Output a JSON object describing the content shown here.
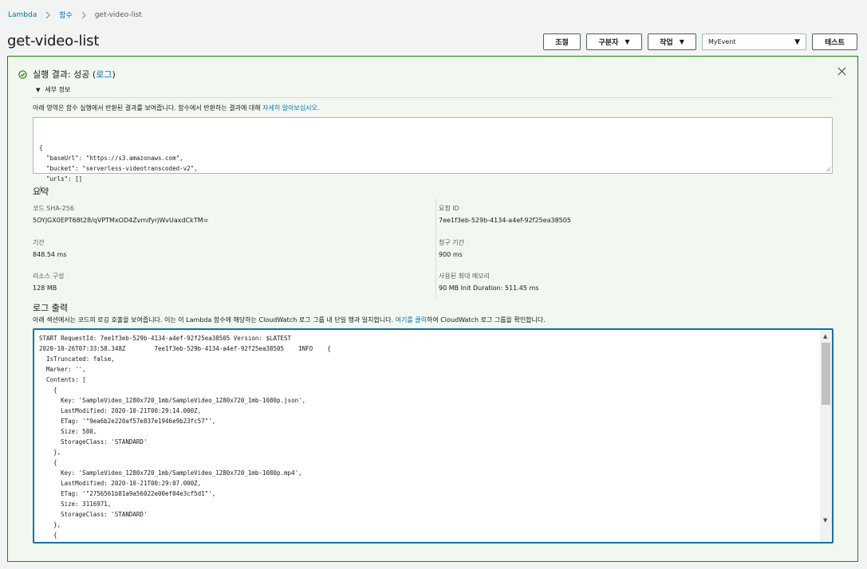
{
  "breadcrumb": {
    "items": [
      "Lambda",
      "함수"
    ],
    "current": "get-video-list"
  },
  "page_title": "get-video-list",
  "toolbar": {
    "adjust_label": "조절",
    "action_label": "구분자",
    "work_label": "작업",
    "event_select_value": "MyEvent",
    "test_label": "테스트"
  },
  "colors": {
    "success_border": "#1d8102",
    "link": "#0073bb",
    "focus": "#0073bb"
  },
  "result": {
    "status_prefix": "실행 결과: 성공 (",
    "status_link": "로그",
    "status_suffix": ")",
    "details_label": "세부 정보",
    "description_prefix": "아래 영역은 함수 실행에서 반환된 결과를 보여줍니다. 함수에서 반환하는 결과에 대해 ",
    "description_link": "자세히 알아보십시오",
    "description_suffix": ".",
    "json_output": "{\n  \"baseUrl\": \"https://s3.amazonaws.com\",\n  \"bucket\": \"serverless-videotranscoded-v2\",\n  \"urls\": []\n}"
  },
  "summary": {
    "title": "요약",
    "code_sha_label": "코드 SHA-256",
    "code_sha_value": "5OYjGX0EPT68t28/qVPTMxOD4ZvmifyrjWvUaxdCkTM=",
    "request_id_label": "요청 ID",
    "request_id_value": "7ee1f3eb-529b-4134-a4ef-92f25ea38505",
    "duration_label": "기간",
    "duration_value": "848.54 ms",
    "billed_label": "청구 기간",
    "billed_value": "900 ms",
    "resources_label": "리소스 구성",
    "resources_value": "128 MB",
    "max_memory_label": "사용된 최대 메모리",
    "max_memory_value": "90 MB Init Duration: 511.45 ms"
  },
  "log": {
    "title": "로그 출력",
    "description_prefix": "아래 섹션에서는 코드의 로깅 호출을 보여줍니다. 이는 이 Lambda 함수에 해당하는 CloudWatch 로그 그룹 내 단일 행과 일치합니다. ",
    "description_link": "여기를 클릭",
    "description_suffix": "하여 CloudWatch 로그 그룹을 확인합니다.",
    "lines": "START RequestId: 7ee1f3eb-529b-4134-a4ef-92f25ea38505 Version: $LATEST\n2020-10-26T07:33:58.348Z\t7ee1f3eb-529b-4134-a4ef-92f25ea38505\tINFO\t{\n  IsTruncated: false,\n  Marker: '',\n  Contents: [\n    {\n      Key: 'SampleVideo_1280x720_1mb/SampleVideo_1280x720_1mb-1080p.json',\n      LastModified: 2020-10-21T00:29:14.000Z,\n      ETag: '\"9ea6b2e220af57e837e1946e9b23fc57\"',\n      Size: 580,\n      StorageClass: 'STANDARD'\n    },\n    {\n      Key: 'SampleVideo_1280x720_1mb/SampleVideo_1280x720_1mb-1080p.mp4',\n      LastModified: 2020-10-21T00:29:07.000Z,\n      ETag: '\"2756561b81a9a56022e00ef04e3cf5d1\"',\n      Size: 3116971,\n      StorageClass: 'STANDARD'\n    },\n    {"
  }
}
